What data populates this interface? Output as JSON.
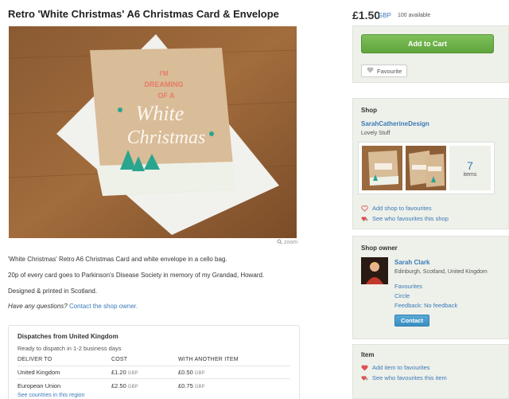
{
  "listing": {
    "title": "Retro 'White Christmas' A6 Christmas Card & Envelope",
    "zoom_label": "zoom",
    "card_text": {
      "line1": "I'M",
      "line2": "DREAMING",
      "line3": "OF A",
      "line4": "White",
      "line5": "Christmas"
    },
    "description": {
      "p1": "'White Christmas' Retro A6 Christmas Card and white envelope in a cello bag.",
      "p2": "20p of every card goes to Parkinson's Disease Society in memory of my Grandad, Howard.",
      "p3": "Designed & printed in Scotland.",
      "question": "Have any questions?",
      "contact_link": "Contact the shop owner."
    }
  },
  "shipping": {
    "title": "Dispatches from United Kingdom",
    "subtitle": "Ready to dispatch in 1-2 business days",
    "headers": [
      "DELIVER TO",
      "COST",
      "WITH ANOTHER ITEM"
    ],
    "rows": [
      {
        "dest": "United Kingdom",
        "cost": "£1.20",
        "another": "£0.50",
        "cur": "GBP"
      },
      {
        "dest": "European Union",
        "cost": "£2.50",
        "another": "£0.75",
        "cur": "GBP"
      }
    ],
    "see_link": "See countries in this region"
  },
  "purchase": {
    "price": "£1.50",
    "currency": "GBP",
    "available": "100 available",
    "add_to_cart": "Add to Cart",
    "favourite": "Favourite"
  },
  "shop": {
    "heading": "Shop",
    "name": "SarahCatherineDesign",
    "tagline": "Lovely Stuff",
    "item_count": "7",
    "items_label": "items",
    "add_fav": "Add shop to favourites",
    "see_fav": "See who favourites this shop"
  },
  "owner": {
    "heading": "Shop owner",
    "name": "Sarah Clark",
    "location": "Edinburgh, Scotland, United Kingdom",
    "links": [
      "Favourites",
      "Circle",
      "Feedback: No feedback"
    ],
    "contact": "Contact"
  },
  "item": {
    "heading": "Item",
    "add_fav": "Add item to favourites",
    "see_fav": "See who favourites this item"
  },
  "colors": {
    "link": "#3a7ab8",
    "cart_green": "#6bb347",
    "panel_bg": "#eef0ea",
    "heart_red": "#e05050"
  }
}
